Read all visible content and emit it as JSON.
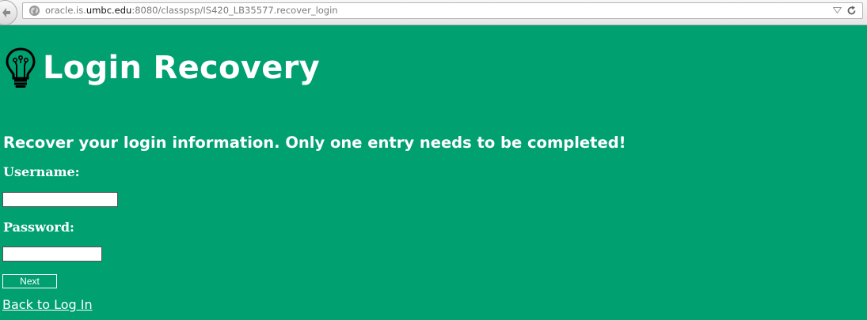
{
  "browser": {
    "url_prefix": "oracle.is.",
    "url_domain": "umbc.edu",
    "url_path": ":8080/classpsp/IS420_LB35577.recover_login"
  },
  "page": {
    "title": "Login Recovery",
    "instructions": "Recover your login information. Only one entry needs to be completed!",
    "username_label": "Username:",
    "username_value": "",
    "password_label": "Password:",
    "password_value": "",
    "next_button_label": "Next",
    "back_link_label": "Back to Log In"
  },
  "colors": {
    "background": "#00a070",
    "text": "#ffffff"
  },
  "icons": {
    "header": "lightbulb-icon",
    "browser_back": "back-arrow-icon",
    "site": "globe-icon",
    "dropdown": "dropdown-icon",
    "reload": "reload-icon"
  }
}
